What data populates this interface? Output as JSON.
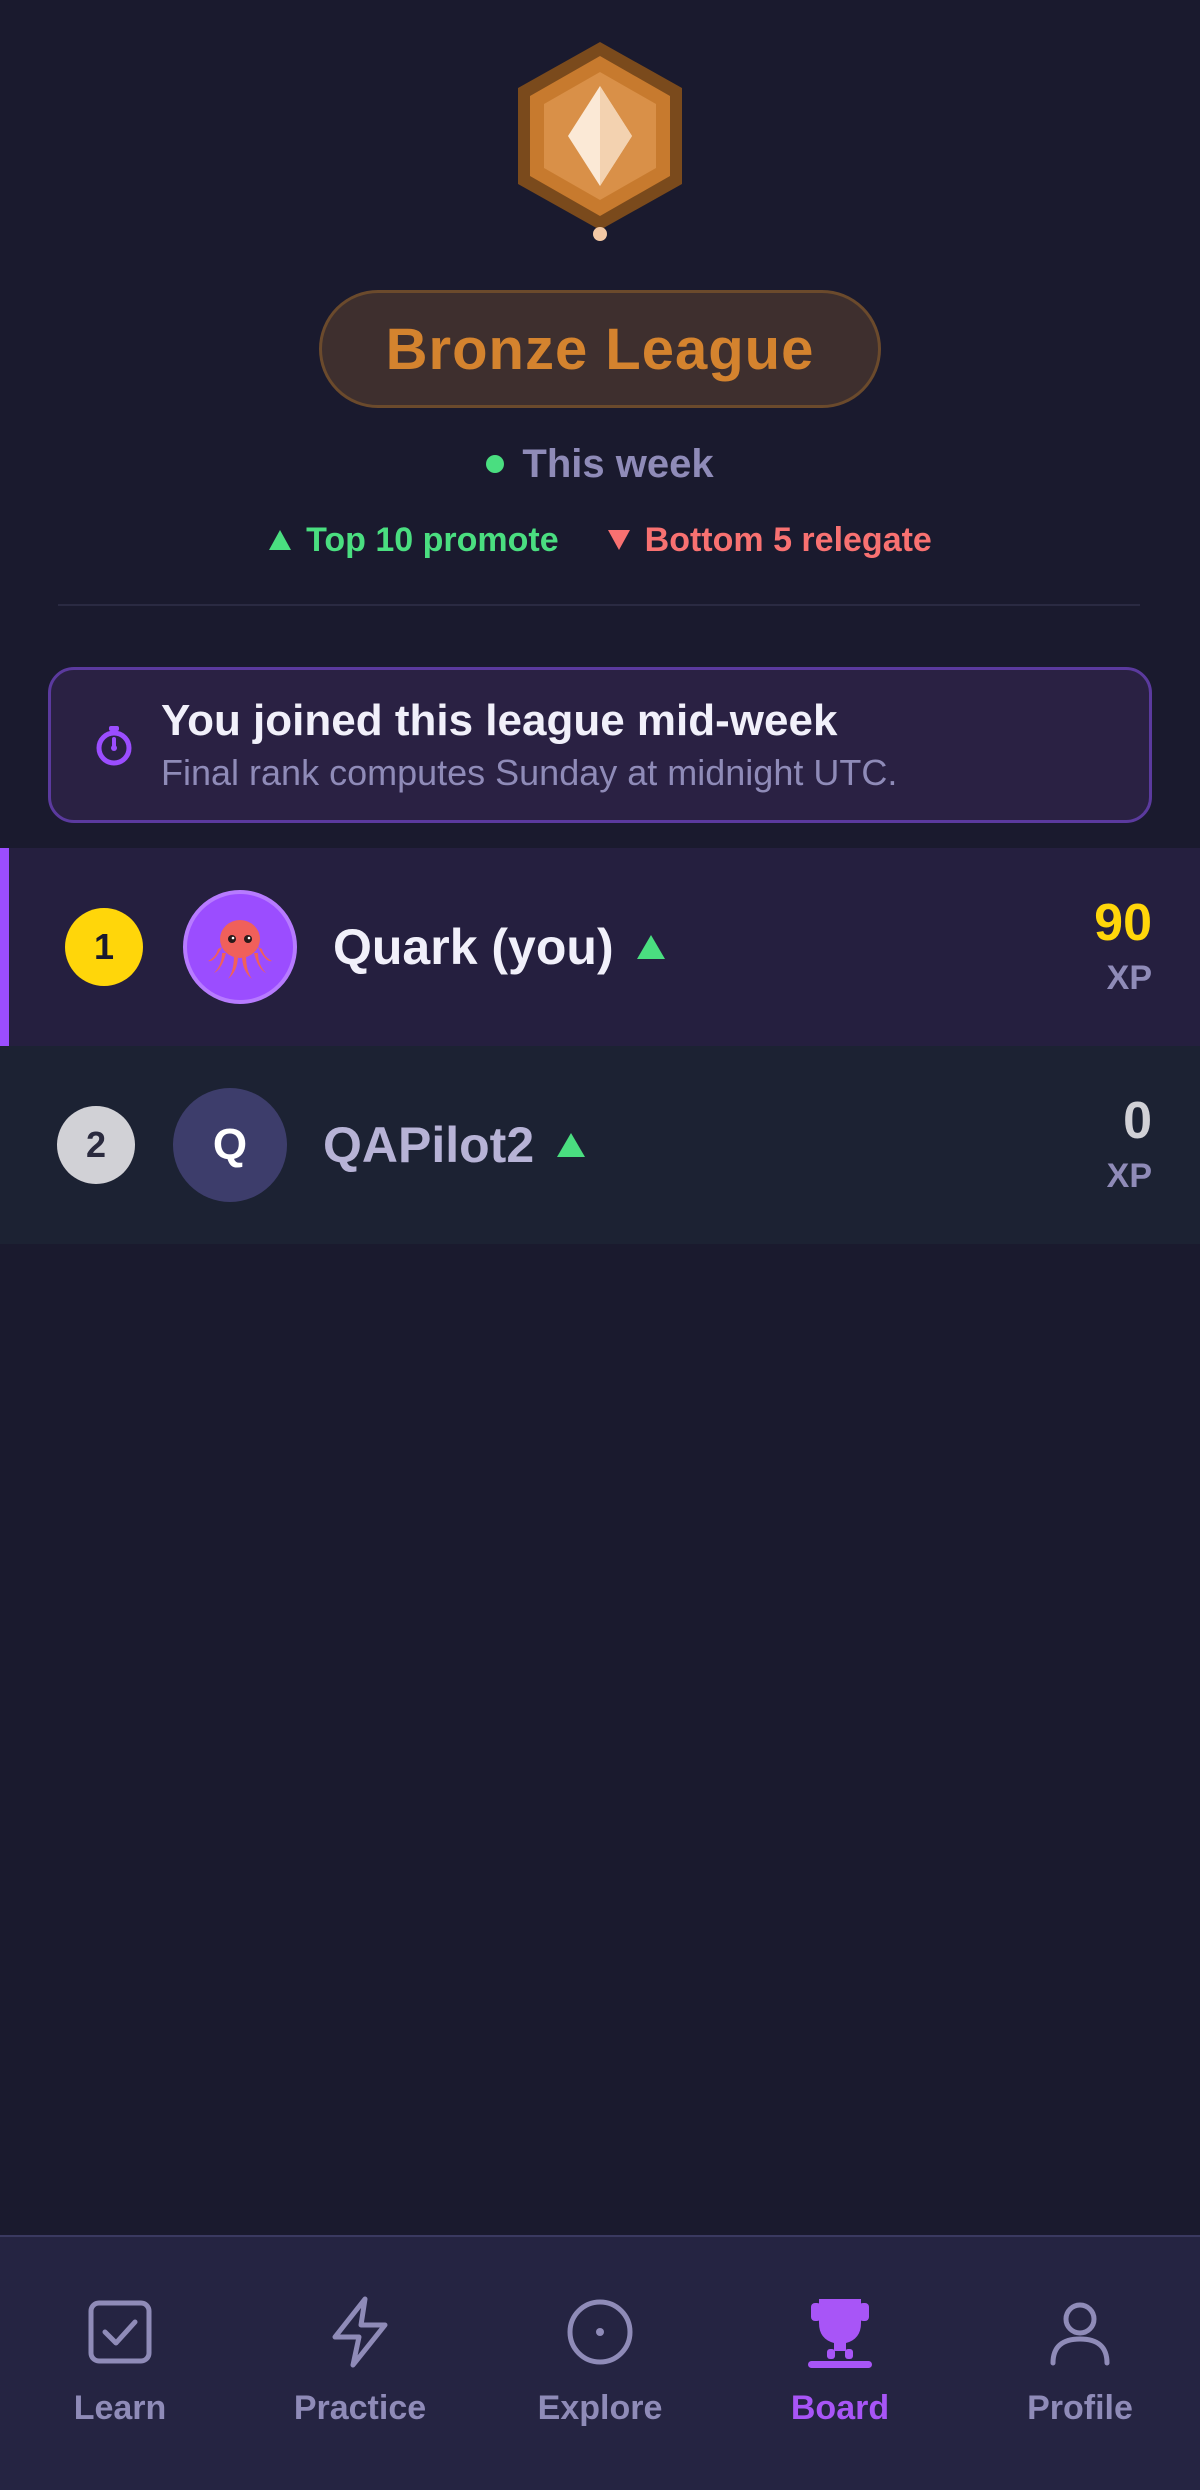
{
  "league": {
    "badge_icon": "bronze-hexagon-badge-icon",
    "name": "Bronze League",
    "period": "This week",
    "promote_text": "Top 10 promote",
    "relegate_text": "Bottom 5 relegate",
    "accent_color": "#d4832e"
  },
  "notice": {
    "icon": "stopwatch-icon",
    "title": "You joined this league mid-week",
    "subtitle": "Final rank computes Sunday at midnight UTC."
  },
  "leaderboard": [
    {
      "rank": "1",
      "avatar": "octopus-emoji",
      "name": "Quark (you)",
      "trend": "up-arrow-icon",
      "xp": "90",
      "xp_unit": "XP"
    },
    {
      "rank": "2",
      "avatar_letter": "Q",
      "name": "QAPilot2",
      "trend": "up-arrow-icon",
      "xp": "0",
      "xp_unit": "XP"
    }
  ],
  "nav": {
    "items": [
      {
        "label": "Learn",
        "icon": "checkbox-icon"
      },
      {
        "label": "Practice",
        "icon": "lightning-icon"
      },
      {
        "label": "Explore",
        "icon": "compass-icon"
      },
      {
        "label": "Board",
        "icon": "trophy-icon",
        "active": true
      },
      {
        "label": "Profile",
        "icon": "user-icon"
      }
    ],
    "active_color": "#a855f7"
  }
}
